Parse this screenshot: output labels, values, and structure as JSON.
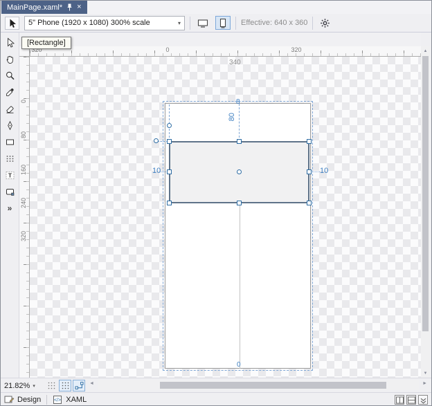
{
  "tab": {
    "title": "MainPage.xaml*"
  },
  "toolbar": {
    "device_combo": "5\" Phone (1920 x 1080) 300% scale",
    "effective": "Effective: 640 x 360"
  },
  "tooltip": {
    "text": "[Rectangle]"
  },
  "rulers": {
    "horizontal": [
      "320",
      "0",
      "320"
    ],
    "width_annotation": "340",
    "vertical": [
      "0",
      "80",
      "160",
      "240",
      "320"
    ]
  },
  "artboard": {
    "top_anchor_glyph": "8",
    "top_offset_label": "80",
    "bottom_anchor_glyph": "0",
    "left_margin_label": "10",
    "right_margin_label": "10"
  },
  "zoom_bar": {
    "zoom_value": "21.82%"
  },
  "status_bar": {
    "design_label": "Design",
    "xaml_label": "XAML"
  },
  "tools": [
    "selection-tool",
    "pan-tool",
    "zoom-tool",
    "eyedropper-tool",
    "eraser-tool",
    "ink-tool",
    "rectangle-tool",
    "grid-tool",
    "text-tool",
    "shape-tool",
    "more-tools"
  ],
  "icons": {
    "close": "×",
    "caret_down": "▾",
    "more_tools": "»",
    "scroll_left": "◄",
    "scroll_right": "►",
    "scroll_up": "▲",
    "scroll_down": "▼"
  },
  "colors": {
    "tab_active_bg": "#4D6287",
    "selection_blue": "#2E6DA4",
    "annotation_blue": "#3E7FC1",
    "effective_gray": "#8D8D8D"
  }
}
